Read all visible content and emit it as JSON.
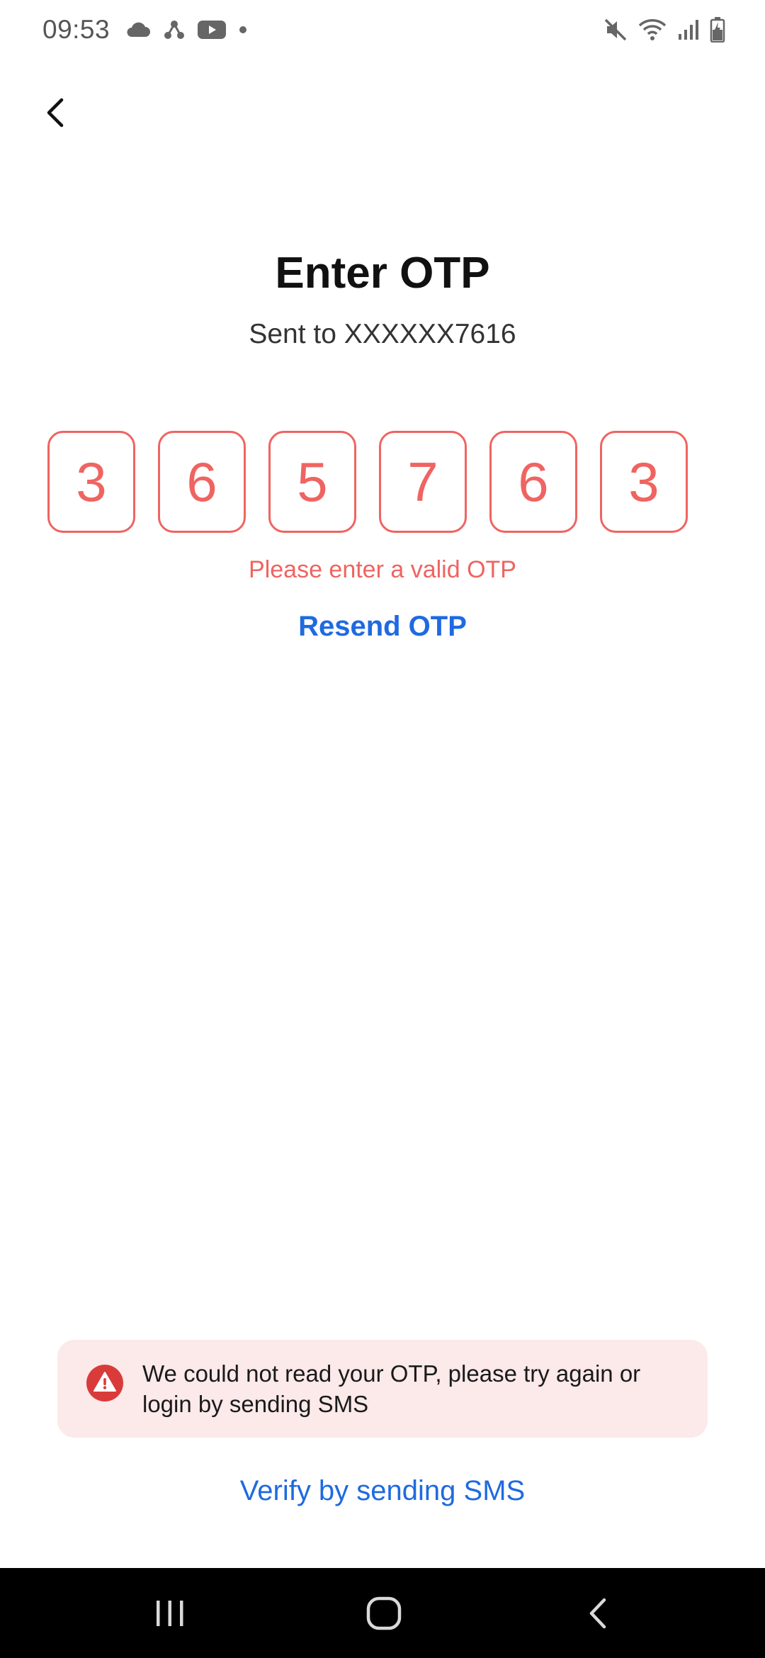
{
  "status_bar": {
    "time": "09:53",
    "left_icons": [
      "cloud-icon",
      "share-hub-icon",
      "youtube-icon",
      "dot-icon"
    ],
    "right_icons": [
      "mute-icon",
      "wifi-icon",
      "signal-icon",
      "battery-icon"
    ]
  },
  "header": {
    "back_icon": "chevron-left-icon",
    "title": "Enter OTP",
    "subtitle": "Sent to XXXXXX7616"
  },
  "otp": {
    "digits": [
      "3",
      "6",
      "5",
      "7",
      "6",
      "3"
    ],
    "error_text": "Please enter a valid OTP",
    "resend_label": "Resend OTP"
  },
  "alert": {
    "icon": "warning-icon",
    "message": "We could not read your OTP, please try again or login by sending SMS"
  },
  "footer": {
    "verify_label": "Verify by sending SMS"
  },
  "nav_bar": {
    "buttons": [
      "recents-icon",
      "home-icon",
      "back-icon"
    ]
  },
  "colors": {
    "error": "#ef6461",
    "link": "#1f6ae0",
    "alert_bg": "#fce9e9",
    "alert_icon": "#d93b3b"
  }
}
